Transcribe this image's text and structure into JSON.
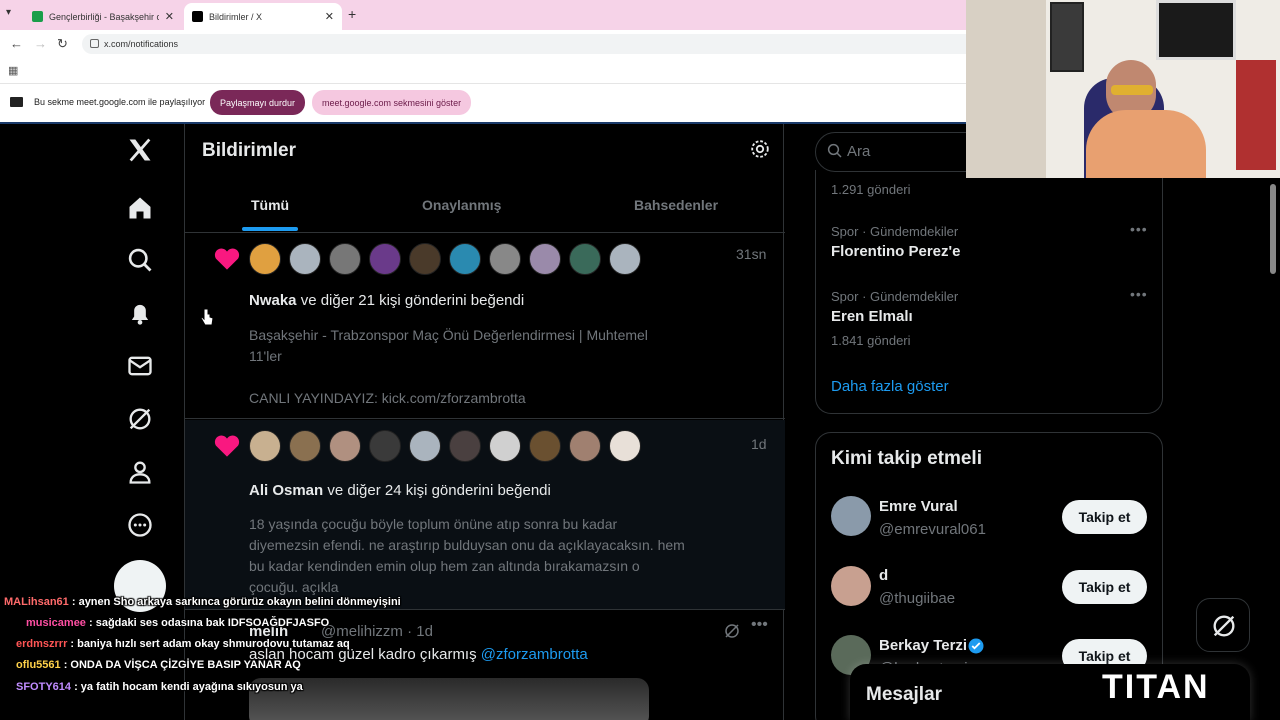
{
  "browser": {
    "tabs": [
      {
        "title": "Gençlerbirliği - Başakşehir canlı",
        "active": false
      },
      {
        "title": "Bildirimler / X",
        "active": true
      }
    ],
    "url": "x.com/notifications",
    "share_bar": {
      "message": "Bu sekme meet.google.com ile paylaşılıyor",
      "stop_label": "Paylaşmayı durdur",
      "show_label": "meet.google.com sekmesini göster"
    }
  },
  "x": {
    "header_title": "Bildirimler",
    "tabs": [
      "Tümü",
      "Onaylanmış",
      "Bahsedenler"
    ],
    "notifications": [
      {
        "time": "31sn",
        "actor": "Nwaka",
        "action": " ve diğer 21 kişi gönderini beğendi",
        "body_lines": [
          "Başakşehir - Trabzonspor Maç Önü Değerlendirmesi | Muhtemel",
          "11'ler",
          "",
          "CANLI YAYINDAYIZ: kick.com/zforzambrotta"
        ]
      },
      {
        "time": "1d",
        "actor": "Ali Osman",
        "action": " ve diğer 24 kişi gönderini beğendi",
        "body_lines": [
          "18 yaşında çocuğu böyle toplum önüne atıp sonra bu kadar",
          "diyemezsin efendi. ne araştırıp bulduysan onu da açıklayacaksın. hem",
          "bu kadar kendinden emin olup hem zan altında bırakamazsın o",
          "çocuğu. açıkla"
        ]
      }
    ],
    "tweet": {
      "name": "melih",
      "handle": "@melihizzm · 1d",
      "text": "aslan hocam güzel kadro çıkarmış ",
      "mention": "@zforzambrotta"
    },
    "search_placeholder": "Ara",
    "trends": [
      {
        "meta": "",
        "name": "",
        "count": "1.291 gönderi"
      },
      {
        "meta": "Spor · Gündemdekiler",
        "name": "Florentino Perez'e",
        "count": ""
      },
      {
        "meta": "Spor · Gündemdekiler",
        "name": "Eren Elmalı",
        "count": "1.841 gönderi"
      }
    ],
    "show_more": "Daha fazla göster",
    "who_to_follow": {
      "title": "Kimi takip etmeli",
      "follow_label": "Takip et",
      "users": [
        {
          "name": "Emre Vural",
          "handle": "@emrevural061"
        },
        {
          "name": "d",
          "handle": "@thugiibae"
        },
        {
          "name": "Berkay Terzi",
          "handle": "@berkayterzi"
        }
      ]
    },
    "messages_title": "Mesajlar"
  },
  "chat": [
    {
      "user": "MALihsan61",
      "color": "#ff6b6b",
      "text": " : aynen Sho arkaya sarkınca görürüz okayın belini dönmeyişini"
    },
    {
      "user": "musicamee",
      "color": "#ff4fa3",
      "text": " : sağdaki ses odasına bak IDFSOAĞDFJASFO"
    },
    {
      "user": "erdmszrrr",
      "color": "#ff5555",
      "text": " : baniya hızlı sert adam okay shmurodovu tutamaz aq"
    },
    {
      "user": "oflu5561",
      "color": "#ffd24a",
      "text": " : ONDA DA VİŞCA ÇİZGİYE BASIP YANAR AQ"
    },
    {
      "user": "SFOTY614",
      "color": "#c08cff",
      "text": " : ya fatih hocam kendi ayağına sıkıyosun ya"
    }
  ],
  "watermark": "TITAN",
  "colors": {
    "accent": "#1d9bf0",
    "like": "#f91880",
    "share_stop": "#7a2858"
  },
  "icons": [
    "x-logo-icon",
    "home-icon",
    "search-icon",
    "bell-icon",
    "mail-icon",
    "grok-icon",
    "profile-icon",
    "more-icon",
    "gear-icon",
    "heart-icon",
    "verified-icon"
  ]
}
